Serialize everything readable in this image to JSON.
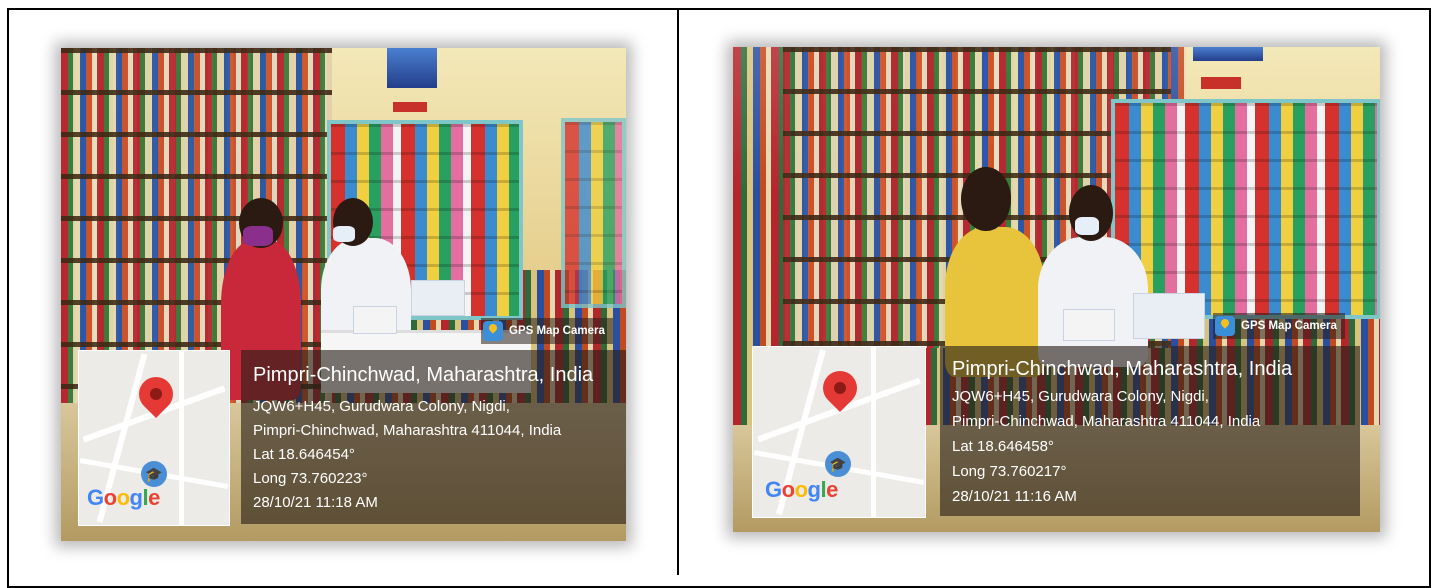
{
  "photos": [
    {
      "badge": "GPS Map Camera",
      "place": "Pimpri-Chinchwad, Maharashtra, India",
      "address1": "JQW6+H45, Gurudwara Colony, Nigdi,",
      "address2": "Pimpri-Chinchwad, Maharashtra 411044, India",
      "lat": "Lat 18.646454°",
      "long": "Long 73.760223°",
      "datetime": "28/10/21 11:18 AM",
      "map_logo": "Google"
    },
    {
      "badge": "GPS Map Camera",
      "place": "Pimpri-Chinchwad, Maharashtra, India",
      "address1": "JQW6+H45, Gurudwara Colony, Nigdi,",
      "address2": "Pimpri-Chinchwad, Maharashtra 411044, India",
      "lat": "Lat 18.646458°",
      "long": "Long 73.760217°",
      "datetime": "28/10/21 11:16 AM",
      "map_logo": "Google"
    }
  ],
  "colors": {
    "pin": "#e53935",
    "overlay": "rgba(40,30,25,0.62)",
    "rack_frame": "#7fc6c9"
  }
}
